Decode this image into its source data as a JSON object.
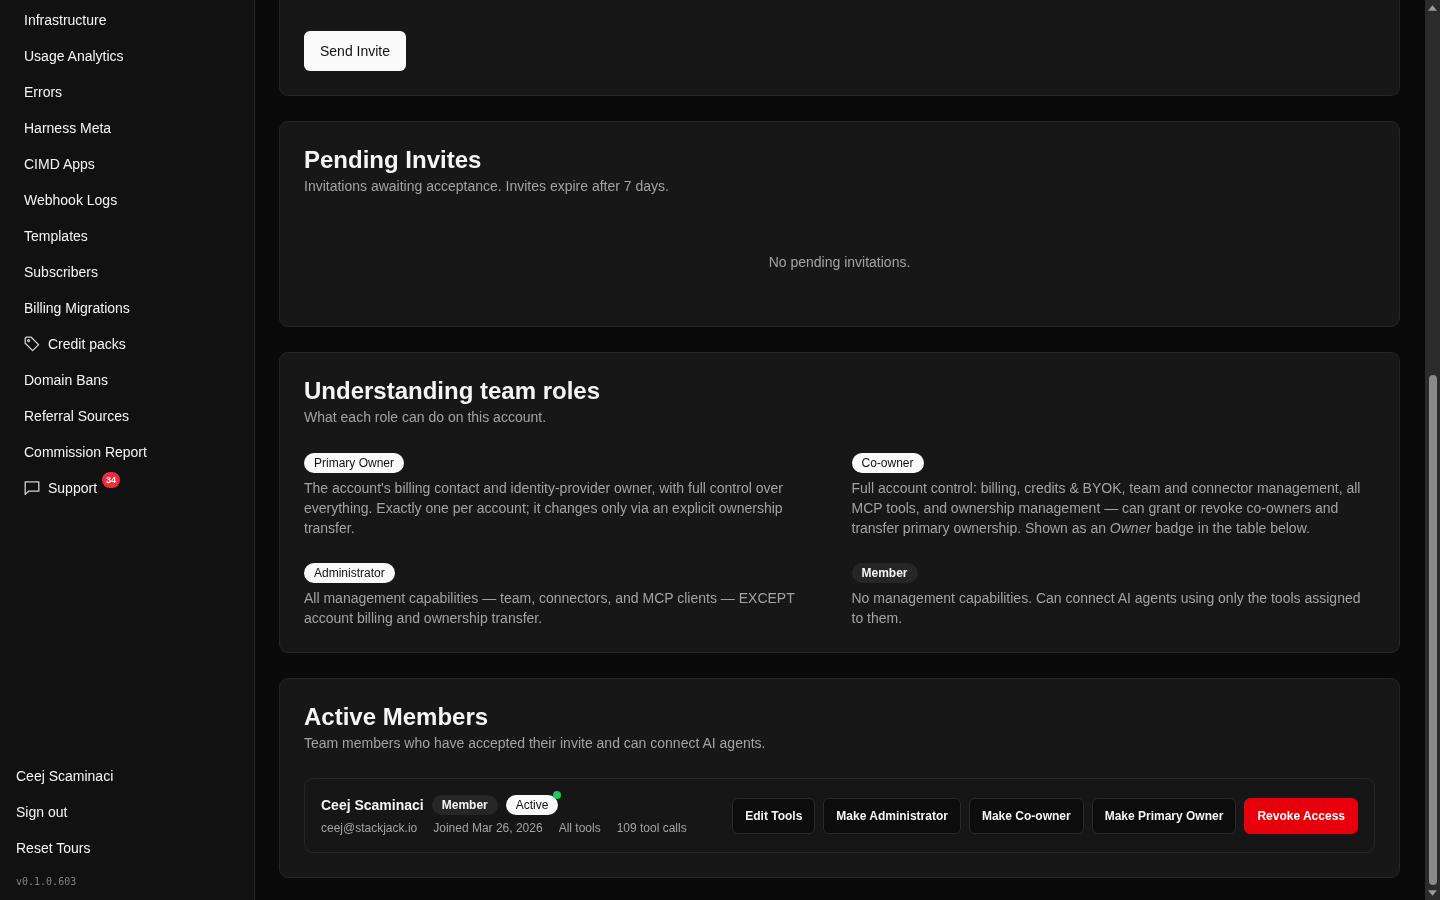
{
  "sidebar": {
    "items": [
      {
        "label": "Infrastructure",
        "kind": "plain"
      },
      {
        "label": "Usage Analytics",
        "kind": "plain"
      },
      {
        "label": "Errors",
        "kind": "plain"
      },
      {
        "label": "Harness Meta",
        "kind": "plain"
      },
      {
        "label": "CIMD Apps",
        "kind": "plain"
      },
      {
        "label": "Webhook Logs",
        "kind": "plain"
      },
      {
        "label": "Templates",
        "kind": "plain"
      },
      {
        "label": "Subscribers",
        "kind": "plain"
      },
      {
        "label": "Billing Migrations",
        "kind": "plain"
      },
      {
        "label": "Credit packs",
        "kind": "pricing"
      },
      {
        "label": "Domain Bans",
        "kind": "plain"
      },
      {
        "label": "Referral Sources",
        "kind": "plain"
      },
      {
        "label": "Commission Report",
        "kind": "plain"
      },
      {
        "label": "Support",
        "kind": "help",
        "badge": "34"
      }
    ],
    "footer": [
      {
        "label": "Ceej Scaminaci"
      },
      {
        "label": "Sign out"
      },
      {
        "label": "Reset Tours"
      }
    ],
    "version": "v0.1.0.603"
  },
  "invite_form": {
    "submit_button": "Send Invite"
  },
  "pending_invites": {
    "title": "Pending Invites",
    "subtitle": "Invitations awaiting acceptance. Invites expire after 7 days.",
    "empty_message": "No pending invitations."
  },
  "team_roles": {
    "title": "Understanding team roles",
    "subtitle": "What each role can do on this account.",
    "roles": [
      {
        "badge": "Primary Owner",
        "elevated": true,
        "description": "The account's billing contact and identity-provider owner, with full control over everything. Exactly one per account; it changes only via an explicit ownership transfer."
      },
      {
        "badge": "Co-owner",
        "elevated": true,
        "description": "Full account control: billing, credits & BYOK, team and connector management, all MCP tools, and ownership management — can grant or revoke co-owners and transfer primary ownership. Shown as an *Owner* badge in the table below."
      },
      {
        "badge": "Administrator",
        "elevated": true,
        "description": "All management capabilities — team, connectors, and MCP clients — EXCEPT account billing and ownership transfer."
      },
      {
        "badge": "Member",
        "elevated": false,
        "description": "No management capabilities. Can connect AI agents using only the tools assigned to them."
      }
    ]
  },
  "active_members": {
    "title": "Active Members",
    "subtitle": "Team members who have accepted their invite and can connect AI agents.",
    "members": [
      {
        "name": "Ceej Scaminaci",
        "role": "Member",
        "status": "Active",
        "online": true,
        "email": "ceej@stackjack.io",
        "joined": "Joined Mar 26, 2026",
        "tools": "All tools",
        "tool_calls": "109 tool calls",
        "actions": [
          {
            "label": "Edit Tools",
            "kind": "default"
          },
          {
            "label": "Make Administrator",
            "kind": "default"
          },
          {
            "label": "Make Co-owner",
            "kind": "default"
          },
          {
            "label": "Make Primary Owner",
            "kind": "default"
          },
          {
            "label": "Revoke Access",
            "kind": "danger"
          }
        ]
      }
    ]
  }
}
